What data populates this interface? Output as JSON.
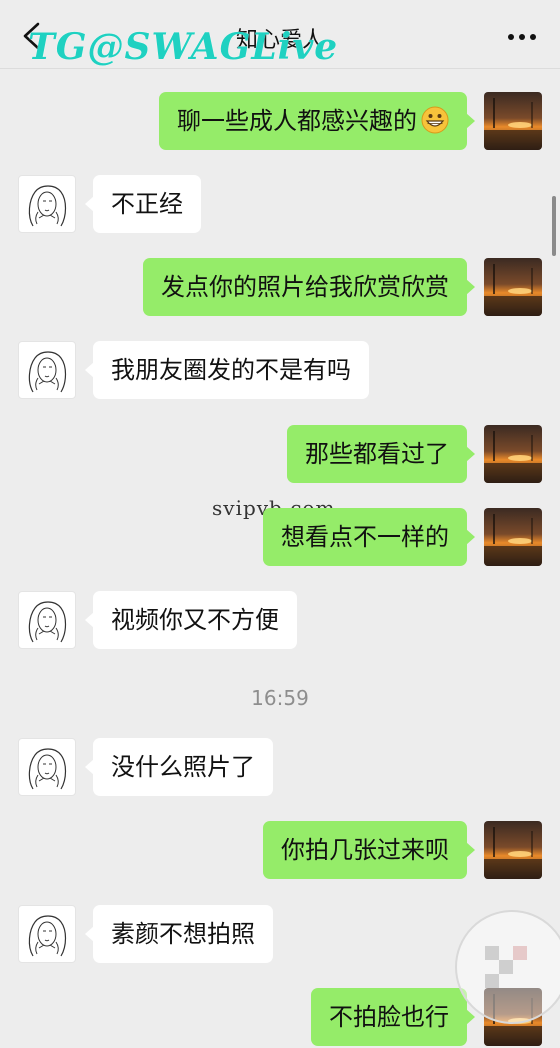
{
  "header": {
    "title": "知心爱人",
    "watermark": "TG@SWAGLive",
    "back_icon": "chevron-left-icon",
    "more_icon": "more-dots-icon"
  },
  "messages": [
    {
      "side": "me",
      "text": "聊一些成人都感兴趣的",
      "emoji": "grinning-face"
    },
    {
      "side": "her",
      "text": "不正经"
    },
    {
      "side": "me",
      "text": "发点你的照片给我欣赏欣赏"
    },
    {
      "side": "her",
      "text": "我朋友圈发的不是有吗"
    },
    {
      "side": "me",
      "text": "那些都看过了"
    },
    {
      "side": "me",
      "text": "想看点不一样的"
    },
    {
      "side": "her",
      "text": "视频你又不方便"
    },
    {
      "side": "her",
      "text": "没什么照片了"
    },
    {
      "side": "me",
      "text": "你拍几张过来呗"
    },
    {
      "side": "her",
      "text": "素颜不想拍照"
    },
    {
      "side": "me",
      "text": "不拍脸也行"
    }
  ],
  "timestamp": "16:59",
  "site_mark": "svipvb.com",
  "colors": {
    "background": "#ededed",
    "bubble_me": "#95ec69",
    "bubble_her": "#ffffff",
    "watermark": "#1fd1c1"
  }
}
